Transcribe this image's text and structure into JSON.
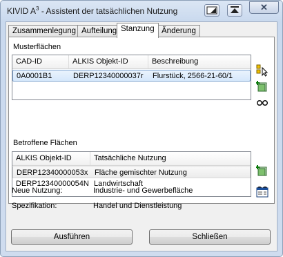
{
  "window": {
    "title_prefix": "KIVID A",
    "title_sup": "3",
    "title_suffix": " - Assistent der tatsächlichen Nutzung",
    "close_glyph": "✕"
  },
  "tabs": [
    {
      "label": "Zusammenlegung",
      "active": false
    },
    {
      "label": "Aufteilung",
      "active": false
    },
    {
      "label": "Stanzung",
      "active": true
    },
    {
      "label": "Änderung",
      "active": false
    }
  ],
  "musterflaechen": {
    "label": "Musterflächen",
    "columns": [
      "CAD-ID",
      "ALKIS Objekt-ID",
      "Beschreibung"
    ],
    "rows": [
      [
        "0A0001B1",
        "DERP12340000037r",
        "Flurstück, 2566-21-60/1"
      ]
    ]
  },
  "betroffene": {
    "label": "Betroffene Flächen",
    "columns": [
      "ALKIS Objekt-ID",
      "Tatsächliche Nutzung"
    ],
    "rows": [
      [
        "DERP12340000053x",
        "Fläche gemischter Nutzung"
      ],
      [
        "DERP12340000054N",
        "Landwirtschaft"
      ]
    ]
  },
  "info": {
    "neue_nutzung_label": "Neue Nutzung:",
    "neue_nutzung_value": "Industrie- und Gewerbefläche",
    "spezifikation_label": "Spezifikation:",
    "spezifikation_value": "Handel und Dienstleistung"
  },
  "buttons": {
    "execute": "Ausführen",
    "close": "Schließen"
  },
  "icons": [
    "select-cursor-icon",
    "add-layer-icon",
    "view-glasses-icon",
    "add-layer-icon",
    "view-glasses-icon",
    "attribute-window-icon"
  ]
}
